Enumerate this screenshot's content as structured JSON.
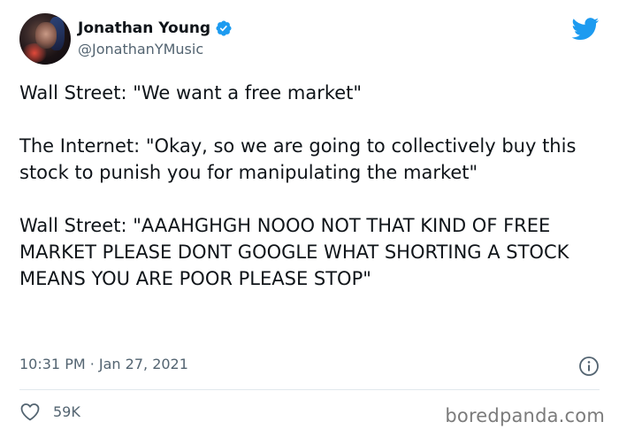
{
  "author": {
    "display_name": "Jonathan Young",
    "handle": "@JonathanYMusic",
    "verified": true
  },
  "tweet": {
    "paragraphs": [
      "Wall Street: \"We want a free market\"",
      "The Internet: \"Okay, so we are going to collectively buy this stock to punish you for manipulating the market\"",
      "Wall Street: \"AAAHGHGH NOOO NOT THAT KIND OF FREE MARKET PLEASE DONT GOOGLE WHAT SHORTING A STOCK MEANS YOU ARE POOR PLEASE STOP\""
    ],
    "timestamp": "10:31 PM · Jan 27, 2021",
    "like_count": "59K"
  },
  "watermark": "boredpanda.com",
  "icons": {
    "verified": "verified-badge-icon",
    "brand": "twitter-bird-icon",
    "info": "info-icon",
    "like": "heart-icon"
  },
  "colors": {
    "twitter_blue": "#1d9bf0",
    "text_primary": "#0f1419",
    "text_secondary": "#536471"
  }
}
